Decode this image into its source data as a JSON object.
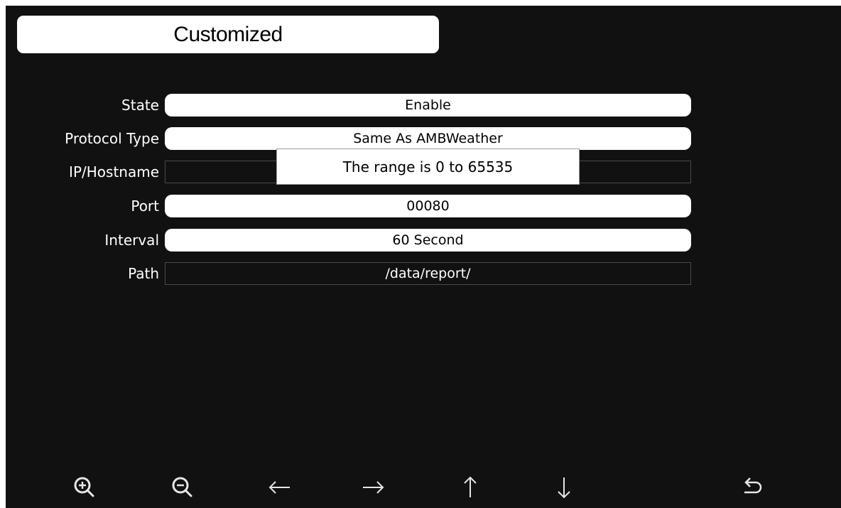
{
  "header": {
    "title": "Customized"
  },
  "form": {
    "rows": [
      {
        "label": "State",
        "value": "Enable"
      },
      {
        "label": "Protocol Type",
        "value": "Same As AMBWeather"
      },
      {
        "label": "IP/Hostname",
        "value": ""
      },
      {
        "label": "Port",
        "value": "00080"
      },
      {
        "label": "Interval",
        "value": "60 Second"
      },
      {
        "label": "Path",
        "value": "/data/report/"
      }
    ]
  },
  "tooltip": {
    "text": "The range is 0 to 65535"
  },
  "toolbar": {
    "icons": [
      "zoom-in-icon",
      "zoom-out-icon",
      "arrow-left-icon",
      "arrow-right-icon",
      "arrow-up-icon",
      "arrow-down-icon",
      "return-icon"
    ]
  },
  "colors": {
    "background": "#111111",
    "field": "#ffffff",
    "text": "#ffffff"
  }
}
